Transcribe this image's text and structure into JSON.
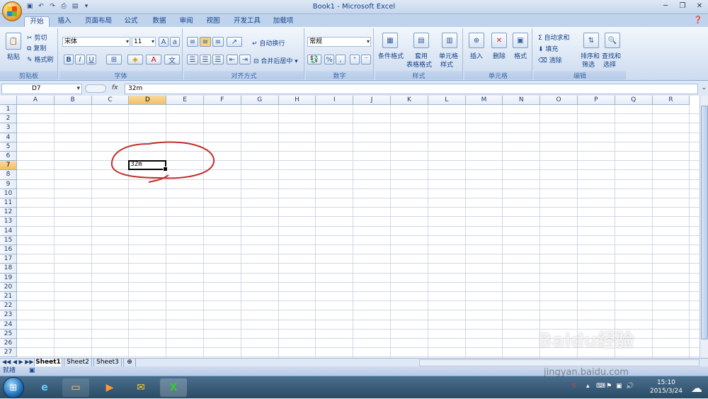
{
  "window": {
    "title": "Book1 - Microsoft Excel"
  },
  "tabs": [
    "开始",
    "插入",
    "页面布局",
    "公式",
    "数据",
    "审阅",
    "视图",
    "开发工具",
    "加载项"
  ],
  "ribbon": {
    "clipboard": {
      "label": "剪贴板",
      "paste": "粘贴",
      "cut": "剪切",
      "copy": "复制",
      "format_painter": "格式刷"
    },
    "font": {
      "label": "字体",
      "font_name": "宋体",
      "font_size": "11",
      "bold": "B",
      "italic": "I",
      "underline": "U"
    },
    "alignment": {
      "label": "对齐方式",
      "wrap": "自动换行",
      "merge": "合并后居中"
    },
    "number": {
      "label": "数字",
      "format": "常规",
      "percent": "%",
      "comma": ","
    },
    "styles": {
      "label": "样式",
      "conditional": "条件格式",
      "table_line1": "套用",
      "table_line2": "表格格式",
      "cell_line1": "单元格",
      "cell_line2": "样式"
    },
    "cells": {
      "label": "单元格",
      "insert": "插入",
      "delete": "删除",
      "format": "格式"
    },
    "editing": {
      "label": "编辑",
      "autosum": "Σ 自动求和",
      "fill": "填充",
      "clear": "清除",
      "sort_line1": "排序和",
      "sort_line2": "筛选",
      "find_line1": "查找和",
      "find_line2": "选择"
    }
  },
  "formula_bar": {
    "name_box": "D7",
    "fx": "fx",
    "value": "32m"
  },
  "columns": [
    "A",
    "B",
    "C",
    "D",
    "E",
    "F",
    "G",
    "H",
    "I",
    "J",
    "K",
    "L",
    "M",
    "N",
    "O",
    "P",
    "Q",
    "R"
  ],
  "rows": [
    "1",
    "2",
    "3",
    "4",
    "5",
    "6",
    "7",
    "8",
    "9",
    "10",
    "11",
    "12",
    "13",
    "14",
    "15",
    "16",
    "17",
    "18",
    "19",
    "20",
    "21",
    "22",
    "23",
    "24",
    "25",
    "26",
    "27"
  ],
  "active_cell": {
    "ref": "D7",
    "value": "32m",
    "column": "D",
    "row": "7"
  },
  "sheets": [
    "Sheet1",
    "Sheet2",
    "Sheet3"
  ],
  "status": {
    "ready": "就绪"
  },
  "taskbar": {
    "time": "15:10",
    "date": "2015/3/24"
  },
  "watermark": {
    "text": "Baidu经验",
    "url": "jingyan.baidu.com"
  }
}
